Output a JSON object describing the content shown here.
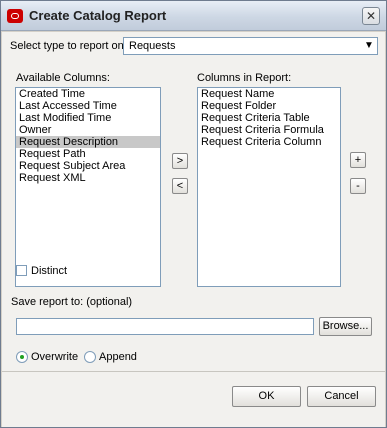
{
  "window": {
    "title": "Create Catalog Report",
    "close_glyph": "✕"
  },
  "type_selector": {
    "label": "Select type to report on:",
    "value": "Requests"
  },
  "available": {
    "label": "Available Columns:",
    "items": [
      "Created Time",
      "Last Accessed Time",
      "Last Modified Time",
      "Owner",
      "Request Description",
      "Request Path",
      "Request Subject Area",
      "Request XML"
    ],
    "selected_index": 4
  },
  "in_report": {
    "label": "Columns in Report:",
    "items": [
      "Request Name",
      "Request Folder",
      "Request Criteria Table",
      "Request Criteria Formula",
      "Request Criteria Column"
    ]
  },
  "move_buttons": {
    "add": ">",
    "remove": "<"
  },
  "order_buttons": {
    "up": "+",
    "down": "-"
  },
  "distinct": {
    "label": "Distinct",
    "checked": false
  },
  "save": {
    "label": "Save report to: (optional)",
    "value": "",
    "browse_label": "Browse..."
  },
  "mode": {
    "overwrite_label": "Overwrite",
    "append_label": "Append",
    "selected": "overwrite"
  },
  "footer": {
    "ok_label": "OK",
    "cancel_label": "Cancel"
  }
}
